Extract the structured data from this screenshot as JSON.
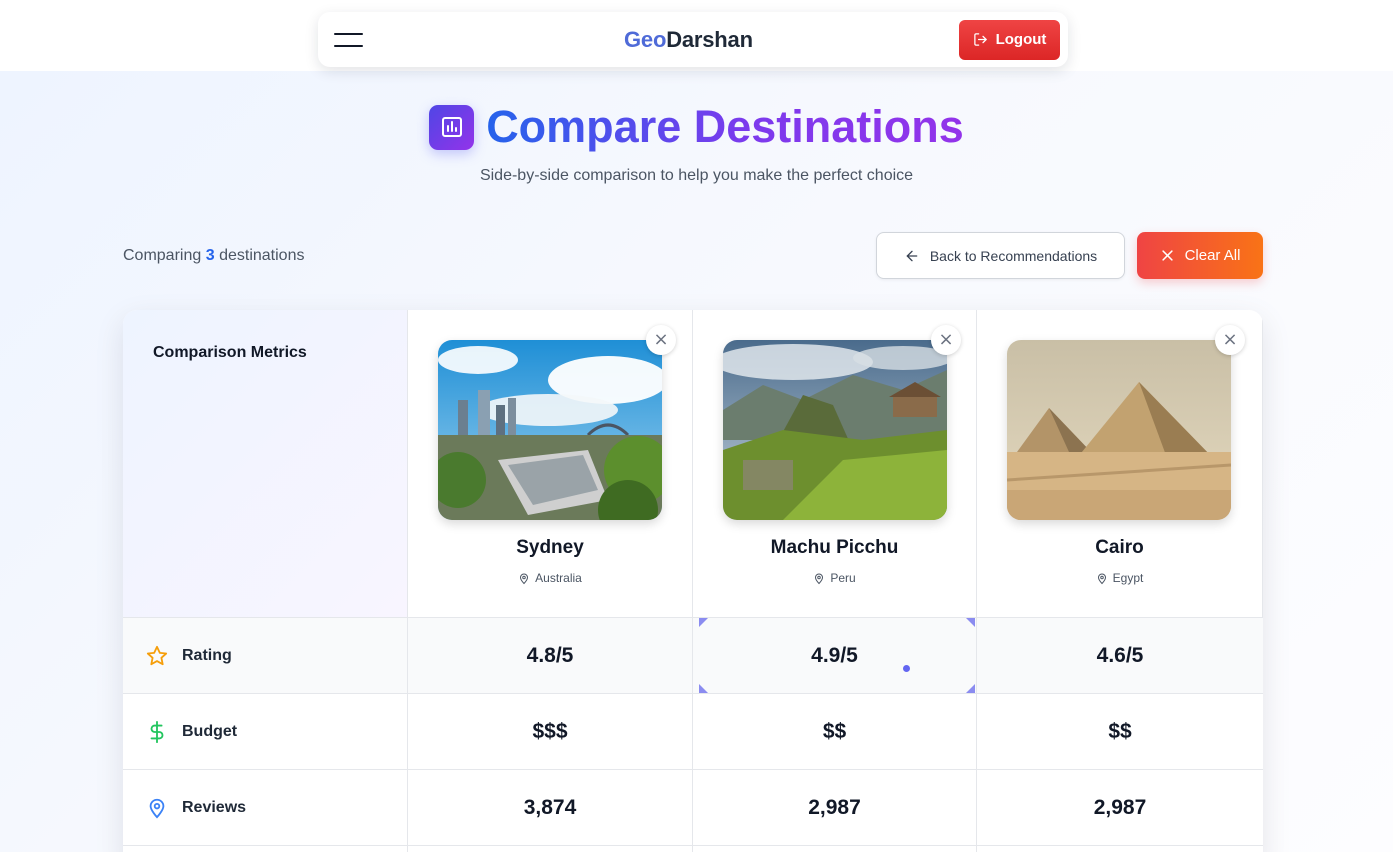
{
  "navbar": {
    "brand_geo": "Geo",
    "brand_darshan": "Darshan",
    "logout_label": "Logout"
  },
  "header": {
    "title": "Compare Destinations",
    "subtitle": "Side-by-side comparison to help you make the perfect choice"
  },
  "toolbar": {
    "comparing_prefix": "Comparing",
    "count": "3",
    "comparing_suffix": "destinations",
    "back_label": "Back to Recommendations",
    "clear_label": "Clear All"
  },
  "table": {
    "metrics_header": "Comparison Metrics",
    "destinations": [
      {
        "name": "Sydney",
        "country": "Australia"
      },
      {
        "name": "Machu Picchu",
        "country": "Peru"
      },
      {
        "name": "Cairo",
        "country": "Egypt"
      }
    ],
    "rows": [
      {
        "label": "Rating",
        "icon": "star-icon",
        "values": [
          "4.8/5",
          "4.9/5",
          "4.6/5"
        ]
      },
      {
        "label": "Budget",
        "icon": "dollar-icon",
        "values": [
          "$$$",
          "$$",
          "$$"
        ]
      },
      {
        "label": "Reviews",
        "icon": "map-pin-icon",
        "values": [
          "3,874",
          "2,987",
          "2,987"
        ]
      }
    ]
  },
  "colors": {
    "accent_blue": "#2563eb",
    "accent_purple": "#9333ea",
    "danger": "#ef4444",
    "star": "#f59e0b",
    "dollar": "#22c55e",
    "pin": "#3b82f6"
  }
}
